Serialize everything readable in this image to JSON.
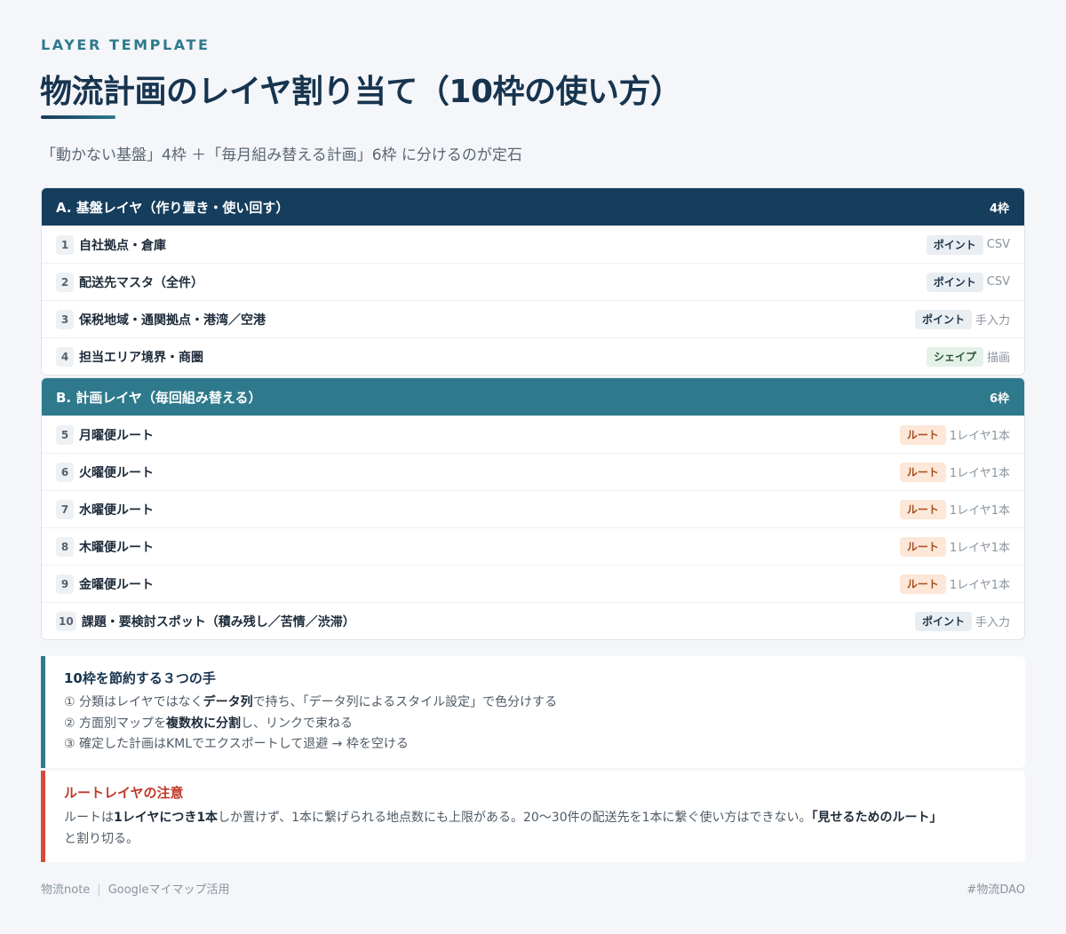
{
  "header": {
    "eyebrow": "LAYER TEMPLATE",
    "title": "物流計画のレイヤ割り当て（10枠の使い方）",
    "subtitle": "「動かない基盤」4枠 ＋「毎月組み替える計画」6枠 に分けるのが定石"
  },
  "groups": [
    {
      "title": "A. 基盤レイヤ（作り置き・使い回す）",
      "count": "4枠",
      "rows": [
        {
          "num": "1",
          "label": "自社拠点・倉庫",
          "tag": "ポイント",
          "note": "CSV"
        },
        {
          "num": "2",
          "label": "配送先マスタ（全件）",
          "tag": "ポイント",
          "note": "CSV"
        },
        {
          "num": "3",
          "label": "保税地域・通関拠点・港湾／空港",
          "tag": "ポイント",
          "note": "手入力"
        },
        {
          "num": "4",
          "label": "担当エリア境界・商圏",
          "tag": "シェイプ",
          "note": "描画"
        }
      ]
    },
    {
      "title": "B. 計画レイヤ（毎回組み替える）",
      "count": "6枠",
      "rows": [
        {
          "num": "5",
          "label": "月曜便ルート",
          "tag": "ルート",
          "note": "1レイヤ1本"
        },
        {
          "num": "6",
          "label": "火曜便ルート",
          "tag": "ルート",
          "note": "1レイヤ1本"
        },
        {
          "num": "7",
          "label": "水曜便ルート",
          "tag": "ルート",
          "note": "1レイヤ1本"
        },
        {
          "num": "8",
          "label": "木曜便ルート",
          "tag": "ルート",
          "note": "1レイヤ1本"
        },
        {
          "num": "9",
          "label": "金曜便ルート",
          "tag": "ルート",
          "note": "1レイヤ1本"
        },
        {
          "num": "10",
          "label": "課題・要検討スポット（積み残し／苦情／渋滞）",
          "tag": "ポイント",
          "note": "手入力"
        }
      ]
    }
  ],
  "tips": {
    "title": "10枠を節約する３つの手",
    "line1": {
      "a": "① 分類はレイヤではなく",
      "b": "データ列",
      "c": "で持ち、「データ列によるスタイル設定」で色分けする"
    },
    "line2": {
      "a": "② 方面別マップを",
      "b": "複数枚に分割",
      "c": "し、リンクで束ねる"
    },
    "line3": "③ 確定した計画はKMLでエクスポートして退避 → 枠を空ける"
  },
  "warning": {
    "title": "ルートレイヤの注意",
    "a": "ルートは",
    "b": "1レイヤにつき1本",
    "c": "しか置けず、1本に繋げられる地点数にも上限がある。20〜30件の配送先を1本に繋ぐ使い方はできない。",
    "d": "「見せるためのルート」",
    "e": "と割り切る。"
  },
  "footer": {
    "brand": "物流note",
    "section": "Googleマイマップ活用",
    "hashtag": "#物流DAO"
  },
  "colors": {
    "group_a": "#153d5c",
    "group_b": "#2e7a8c",
    "accent": "#2e7a8c",
    "warning": "#d64a3b"
  }
}
